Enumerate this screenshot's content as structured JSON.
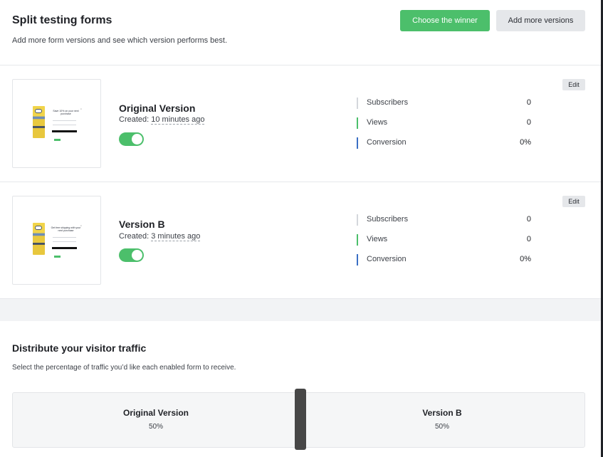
{
  "header": {
    "title": "Split testing forms",
    "subtitle": "Add more form versions and see which version performs best.",
    "choose_winner_label": "Choose the winner",
    "add_versions_label": "Add more versions"
  },
  "versions": [
    {
      "name": "Original Version",
      "created_prefix": "Created: ",
      "created_time": "10 minutes ago",
      "enabled": true,
      "edit_label": "Edit",
      "thumbnail_text": "Save 10% on your next purchase",
      "stats": [
        {
          "label": "Subscribers",
          "value": "0",
          "color": "#d4d7dc"
        },
        {
          "label": "Views",
          "value": "0",
          "color": "#4cbf6b"
        },
        {
          "label": "Conversion",
          "value": "0%",
          "color": "#3b6fc4"
        }
      ]
    },
    {
      "name": "Version B",
      "created_prefix": "Created: ",
      "created_time": "3 minutes ago",
      "enabled": true,
      "edit_label": "Edit",
      "thumbnail_text": "Get free shipping with your next purchase",
      "stats": [
        {
          "label": "Subscribers",
          "value": "0",
          "color": "#d4d7dc"
        },
        {
          "label": "Views",
          "value": "0",
          "color": "#4cbf6b"
        },
        {
          "label": "Conversion",
          "value": "0%",
          "color": "#3b6fc4"
        }
      ]
    }
  ],
  "distribution": {
    "title": "Distribute your visitor traffic",
    "subtitle": "Select the percentage of traffic you’d like each enabled form to receive.",
    "segments": [
      {
        "name": "Original Version",
        "percent": "50%"
      },
      {
        "name": "Version B",
        "percent": "50%"
      }
    ]
  },
  "colors": {
    "accent": "#4cbf6b",
    "secondary_button": "#e5e7ea",
    "handle": "#474747"
  }
}
